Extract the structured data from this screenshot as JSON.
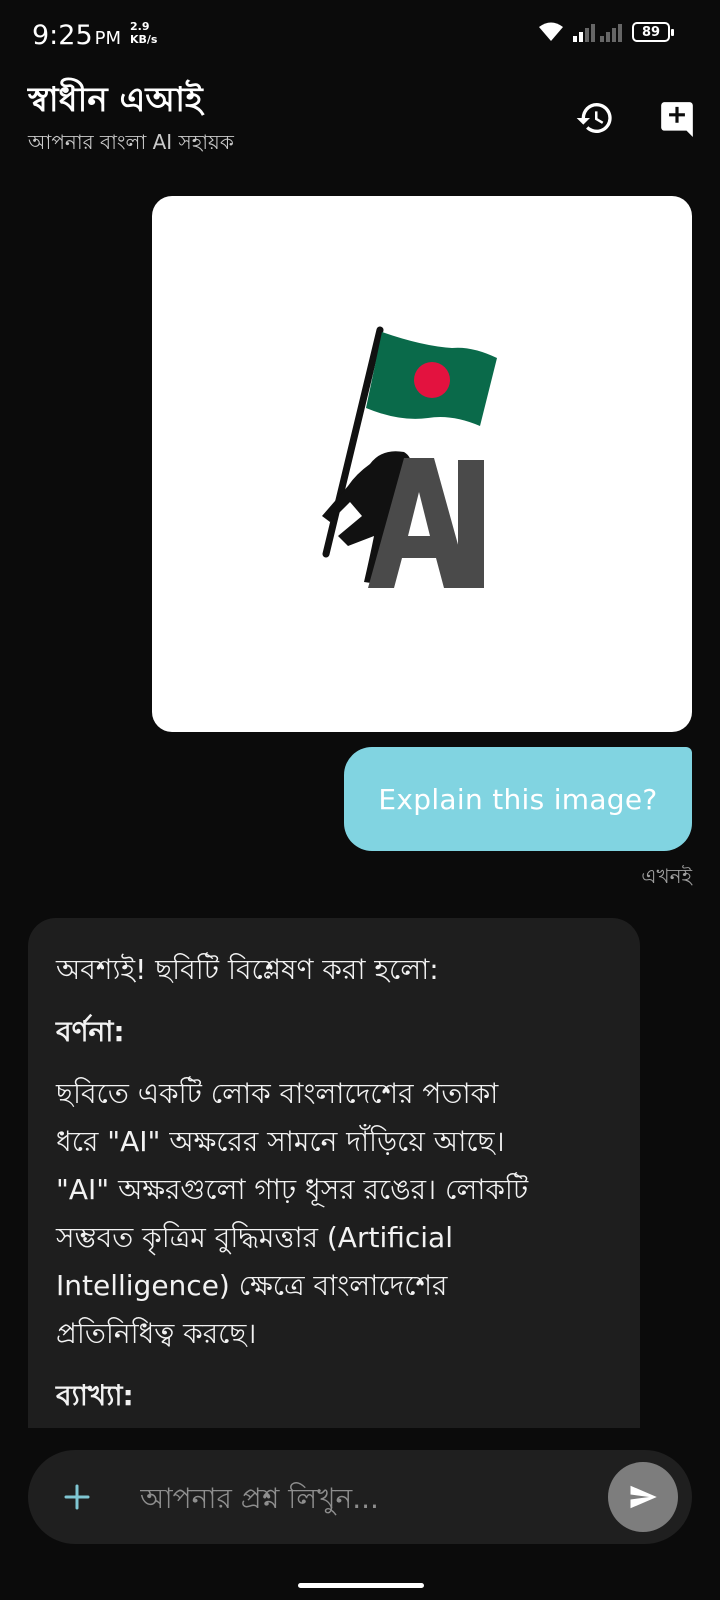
{
  "status_bar": {
    "time": "9:25",
    "ampm": "PM",
    "net_speed_value": "2.9",
    "net_speed_unit": "KB/s",
    "battery": "89"
  },
  "header": {
    "title": "স্বাধীন এআই",
    "subtitle": "আপনার বাংলা AI সহায়ক",
    "icons": [
      "history-icon",
      "new-chat-icon"
    ]
  },
  "conversation": {
    "image_message": {
      "logo_text": "AI",
      "colors": {
        "flag_green": "#0a6a4a",
        "flag_red": "#e3123f",
        "text_gray": "#4a4a4a"
      }
    },
    "user_message": {
      "text": "Explain this image?",
      "timestamp": "এখনই"
    },
    "assistant_message": {
      "intro": "অবশ্যই! ছবিটি বিশ্লেষণ করা হলো:",
      "heading_description": "বর্ণনা:",
      "description_lines": [
        "ছবিতে একটি লোক বাংলাদেশের পতাকা",
        "ধরে \"AI\" অক্ষরের সামনে দাঁড়িয়ে আছে।",
        "\"AI\" অক্ষরগুলো গাঢ় ধূসর রঙের। লোকটি",
        "সম্ভবত কৃত্রিম বুদ্ধিমত্তার (Artificial",
        "Intelligence) ক্ষেত্রে বাংলাদেশের",
        "প্রতিনিধিত্ব করছে।"
      ],
      "heading_explanation": "ব্যাখ্যা:"
    }
  },
  "composer": {
    "placeholder": "আপনার প্রশ্ন লিখুন..."
  },
  "colors": {
    "background": "#0b0b0b",
    "user_bubble": "#81d4e1",
    "assistant_bubble": "#1e1e1e",
    "send_button": "#7d7d7d"
  }
}
